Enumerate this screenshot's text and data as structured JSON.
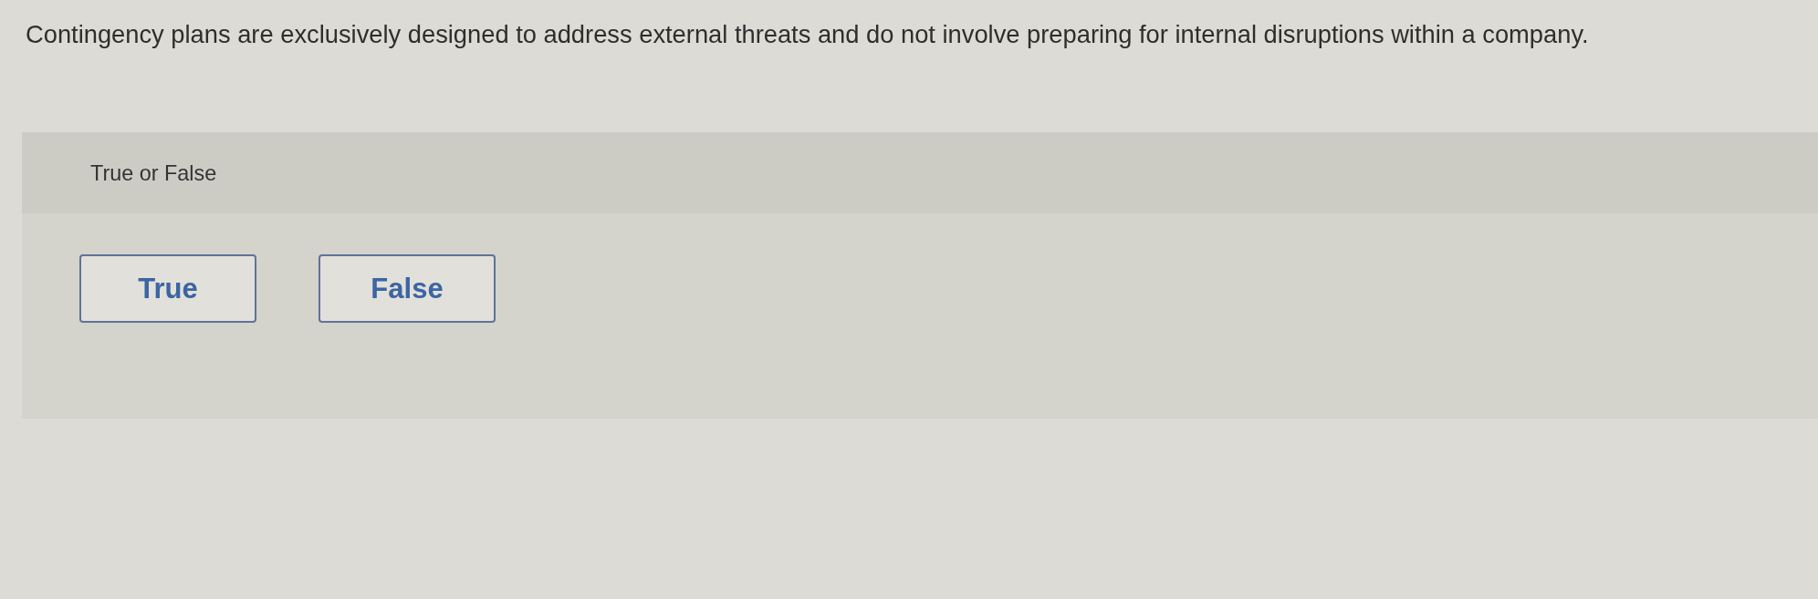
{
  "question": {
    "text": "Contingency plans are exclusively designed to address external threats and do not involve preparing for internal disruptions within a company."
  },
  "prompt": {
    "label": "True or False"
  },
  "options": [
    {
      "label": "True",
      "selected": false
    },
    {
      "label": "False",
      "selected": false
    }
  ]
}
